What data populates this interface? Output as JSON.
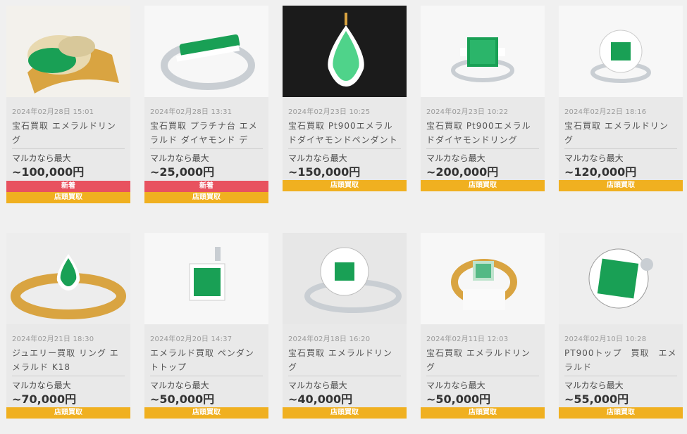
{
  "items": [
    {
      "date": "2024年02月28日 15:01",
      "title": "宝石買取 エメラルドリング",
      "prefix": "マルカなら最大",
      "price": "~100,000円",
      "new_label": "新着",
      "store_label": "店頭買取",
      "gem": "emerald-cluster"
    },
    {
      "date": "2024年02月28日 13:31",
      "title": "宝石買取 プラチナ台 エメラルド ダイヤモンド デ",
      "prefix": "マルカなら最大",
      "price": "~25,000円",
      "new_label": "新着",
      "store_label": "店頭買取",
      "gem": "emerald-band"
    },
    {
      "date": "2024年02月23日 10:25",
      "title": "宝石買取 Pt900エメラルドダイヤモンドペンダント",
      "prefix": "マルカなら最大",
      "price": "~150,000円",
      "new_label": "",
      "store_label": "店頭買取",
      "gem": "pear-pendant"
    },
    {
      "date": "2024年02月23日 10:22",
      "title": "宝石買取 Pt900エメラルドダイヤモンドリング",
      "prefix": "マルカなら最大",
      "price": "~200,000円",
      "new_label": "",
      "store_label": "店頭買取",
      "gem": "square-ring"
    },
    {
      "date": "2024年02月22日 18:16",
      "title": "宝石買取 エメラルドリング",
      "prefix": "マルカなら最大",
      "price": "~120,000円",
      "new_label": "",
      "store_label": "店頭買取",
      "gem": "halo-ring"
    },
    {
      "date": "2024年02月21日 18:30",
      "title": "ジュエリー買取 リング エメラルド K18",
      "prefix": "マルカなら最大",
      "price": "~70,000円",
      "new_label": "",
      "store_label": "店頭買取",
      "gem": "gold-pear-ring"
    },
    {
      "date": "2024年02月20日 14:37",
      "title": "エメラルド買取 ペンダントトップ",
      "prefix": "マルカなら最大",
      "price": "~50,000円",
      "new_label": "",
      "store_label": "店頭買取",
      "gem": "small-pendant"
    },
    {
      "date": "2024年02月18日 16:20",
      "title": "宝石買取 エメラルドリング",
      "prefix": "マルカなら最大",
      "price": "~40,000円",
      "new_label": "",
      "store_label": "店頭買取",
      "gem": "flower-ring"
    },
    {
      "date": "2024年02月11日 12:03",
      "title": "宝石買取 エメラルドリング",
      "prefix": "マルカなら最大",
      "price": "~50,000円",
      "new_label": "",
      "store_label": "店頭買取",
      "gem": "gold-square-ring"
    },
    {
      "date": "2024年02月10日 10:28",
      "title": "PT900トップ　買取　エメラルド",
      "prefix": "マルカなら最大",
      "price": "~55,000円",
      "new_label": "",
      "store_label": "店頭買取",
      "gem": "large-top"
    }
  ],
  "colors": {
    "new_badge": "#e8525f",
    "store_badge": "#f0b020",
    "emerald": "#1fa35a",
    "gold": "#d9a441",
    "platinum": "#c8ccd0"
  }
}
